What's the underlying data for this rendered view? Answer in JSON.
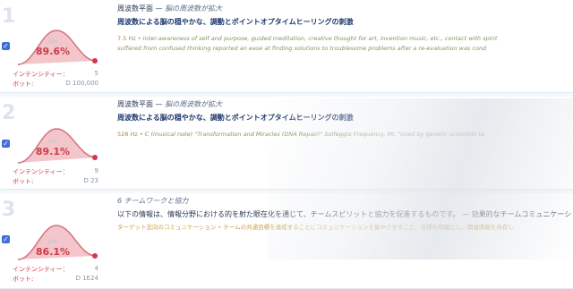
{
  "results": [
    {
      "index": "1",
      "percent": "89.6%",
      "percent_small": "Em",
      "intensity_label": "インテンシティー：",
      "intensity_value": "5",
      "bot_label": "ボット:",
      "bot_value": "D 100,000",
      "title_main": "周波数平面",
      "title_sep": " — ",
      "title_sub": "脳の周波数が拡大",
      "headline": "周波数による脳の穏やかな、調動とポイントオプタイムヒーリングの刺激",
      "desc_freq": "7.5 Hz",
      "desc_line1": " • Inter-awareness of self and purpose, guided meditation, creative thought for art, invention music, etc., contact with spirit",
      "desc_line2": "suffered from confused thinking reported an ease at finding solutions to troublesome problems after a re-evaluation was cond"
    },
    {
      "index": "2",
      "percent": "89.1%",
      "percent_small": "Em",
      "intensity_label": "インテンシティー：",
      "intensity_value": "9",
      "bot_label": "ボット:",
      "bot_value": "D 23",
      "title_main": "周波数平面",
      "title_sep": " — ",
      "title_sub": "脳の周波数が拡大",
      "headline": "周波数による脳の穏やかな、調動とポイントオプタイムヒーリングの刺激",
      "desc_freq": "528 Hz",
      "desc_line1": " • C (musical note) \"Transformation and Miracles (DNA Repair)\" Solfeggio Frequency, MI, \"Used by genetic scientists to",
      "desc_line2": ""
    },
    {
      "index": "3",
      "percent": "86.1%",
      "percent_small": "Em",
      "intensity_label": "インテンシティー：",
      "intensity_value": "4",
      "bot_label": "ボット:",
      "bot_value": "D 1E24",
      "title_main": "",
      "title_sep": "",
      "title_sub": "6 チームワークと協力",
      "headline": "以下の情報は、情報分野における的を射た眼在化を通じて、チームスピリットと協力を促進するものです。 — 効果的なチームコミュニケーション",
      "desc_freq": "",
      "desc_line1": "ターゲット志向のコミュニケーション • チームの共通目標を達成することにコミュニケーションを集中させること、目標を明確にし、関連情報を共有し",
      "desc_line2": ""
    }
  ],
  "colors": {
    "accent_red": "#d03a4a",
    "checkbox_blue": "#3f6fd8",
    "gauge_fill": "#f3c6cb",
    "gauge_line": "#d9727e",
    "gauge_green": "#8fb89a",
    "desc_green": "#7c9a5a",
    "desc_meta": "#b7863f"
  },
  "icons": {
    "checkbox": "checkmark-icon",
    "gauge": "bell-curve-gauge-icon"
  }
}
